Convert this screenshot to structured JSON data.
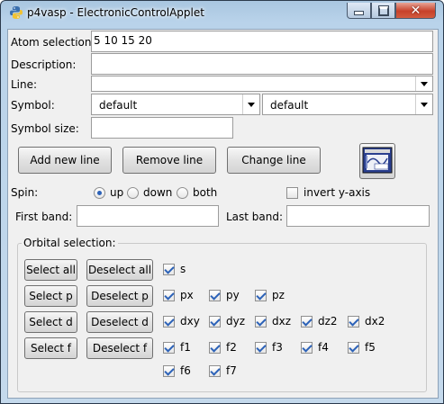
{
  "window": {
    "title": "p4vasp - ElectronicControlApplet",
    "icon": "python-icon",
    "controls": [
      "minimize-icon",
      "maximize-icon",
      "close-icon"
    ]
  },
  "form": {
    "atom_selection": {
      "label": "Atom selection:",
      "value": "5 10 15 20"
    },
    "description": {
      "label": "Description:",
      "value": ""
    },
    "line": {
      "label": "Line:",
      "value": ""
    },
    "symbol": {
      "label": "Symbol:",
      "value1": "default",
      "value2": "default"
    },
    "symbol_size": {
      "label": "Symbol size:",
      "value": ""
    }
  },
  "buttons": {
    "add_line": "Add new line",
    "remove_line": "Remove line",
    "change_line": "Change line",
    "graph_icon": "embed-graph-icon"
  },
  "spin": {
    "label": "Spin:",
    "options": [
      "up",
      "down",
      "both"
    ],
    "selected": "up"
  },
  "invert_y": {
    "label": "invert y-axis",
    "checked": false
  },
  "bands": {
    "first_label": "First band:",
    "first_value": "",
    "last_label": "Last band:",
    "last_value": ""
  },
  "orbital": {
    "legend": "Orbital selection:",
    "select_all": "Select all",
    "deselect_all": "Deselect all",
    "select_p": "Select p",
    "deselect_p": "Deselect p",
    "select_d": "Select d",
    "deselect_d": "Deselect d",
    "select_f": "Select f",
    "deselect_f": "Deselect f",
    "s": [
      "s"
    ],
    "p": [
      "px",
      "py",
      "pz"
    ],
    "d": [
      "dxy",
      "dyz",
      "dxz",
      "dz2",
      "dx2"
    ],
    "f1": [
      "f1",
      "f2",
      "f3",
      "f4",
      "f5"
    ],
    "f2": [
      "f6",
      "f7"
    ]
  }
}
